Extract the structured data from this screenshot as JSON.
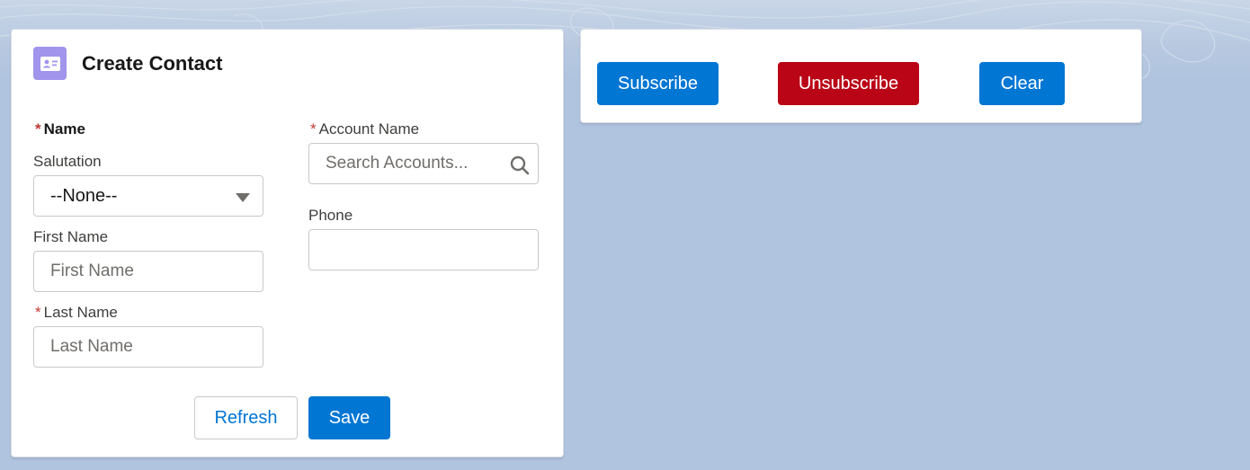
{
  "contact_form": {
    "title": "Create Contact",
    "icon": "contact-card-icon",
    "name_section_label": "Name",
    "salutation": {
      "label": "Salutation",
      "value": "--None--"
    },
    "first_name": {
      "label": "First Name",
      "placeholder": "First Name",
      "value": ""
    },
    "last_name": {
      "label": "Last Name",
      "placeholder": "Last Name",
      "value": ""
    },
    "account_name": {
      "label": "Account Name",
      "placeholder": "Search Accounts...",
      "value": ""
    },
    "phone": {
      "label": "Phone",
      "value": ""
    },
    "required_marker": "*",
    "refresh_label": "Refresh",
    "save_label": "Save"
  },
  "actions": {
    "subscribe_label": "Subscribe",
    "unsubscribe_label": "Unsubscribe",
    "clear_label": "Clear"
  },
  "colors": {
    "brand": "#0176d3",
    "destructive": "#ba0517",
    "icon_bg": "#a094ed",
    "background": "#b0c4df"
  }
}
